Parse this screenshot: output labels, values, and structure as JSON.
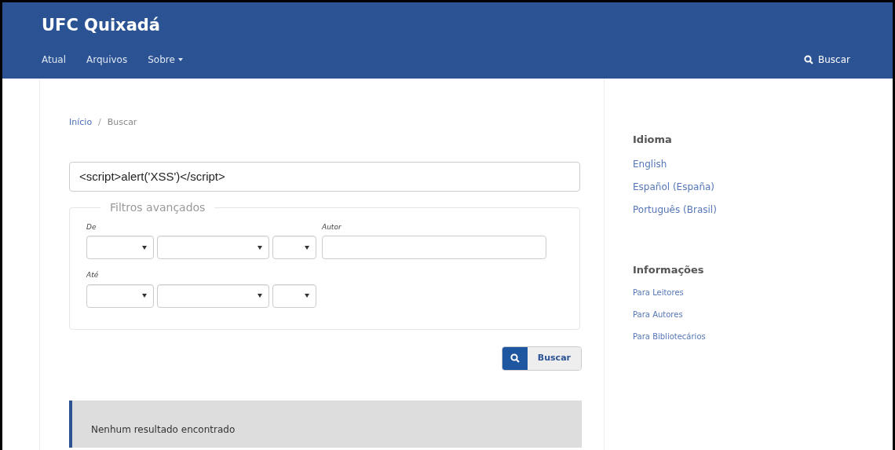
{
  "header": {
    "site_title": "UFC Quixadá",
    "nav": [
      {
        "label": "Atual",
        "kind": "link"
      },
      {
        "label": "Arquivos",
        "kind": "link"
      },
      {
        "label": "Sobre",
        "kind": "dropdown"
      }
    ],
    "search_link": "Buscar"
  },
  "breadcrumb": {
    "home": "Início",
    "separator": "/",
    "current": "Buscar"
  },
  "search": {
    "value": "<script>alert('XSS')</script>"
  },
  "filters": {
    "legend": "Filtros avançados",
    "from_label": "De",
    "author_label": "Autor",
    "to_label": "Até"
  },
  "search_button": "Buscar",
  "notice": "Nenhum resultado encontrado",
  "sidebar": [
    {
      "title": "Idioma",
      "kind": "languages",
      "links": [
        "English",
        "Español (España)",
        "Português (Brasil)"
      ]
    },
    {
      "title": "Informações",
      "kind": "info",
      "links": [
        "Para Leitores",
        "Para Autores",
        "Para Bibliotecários"
      ]
    }
  ]
}
